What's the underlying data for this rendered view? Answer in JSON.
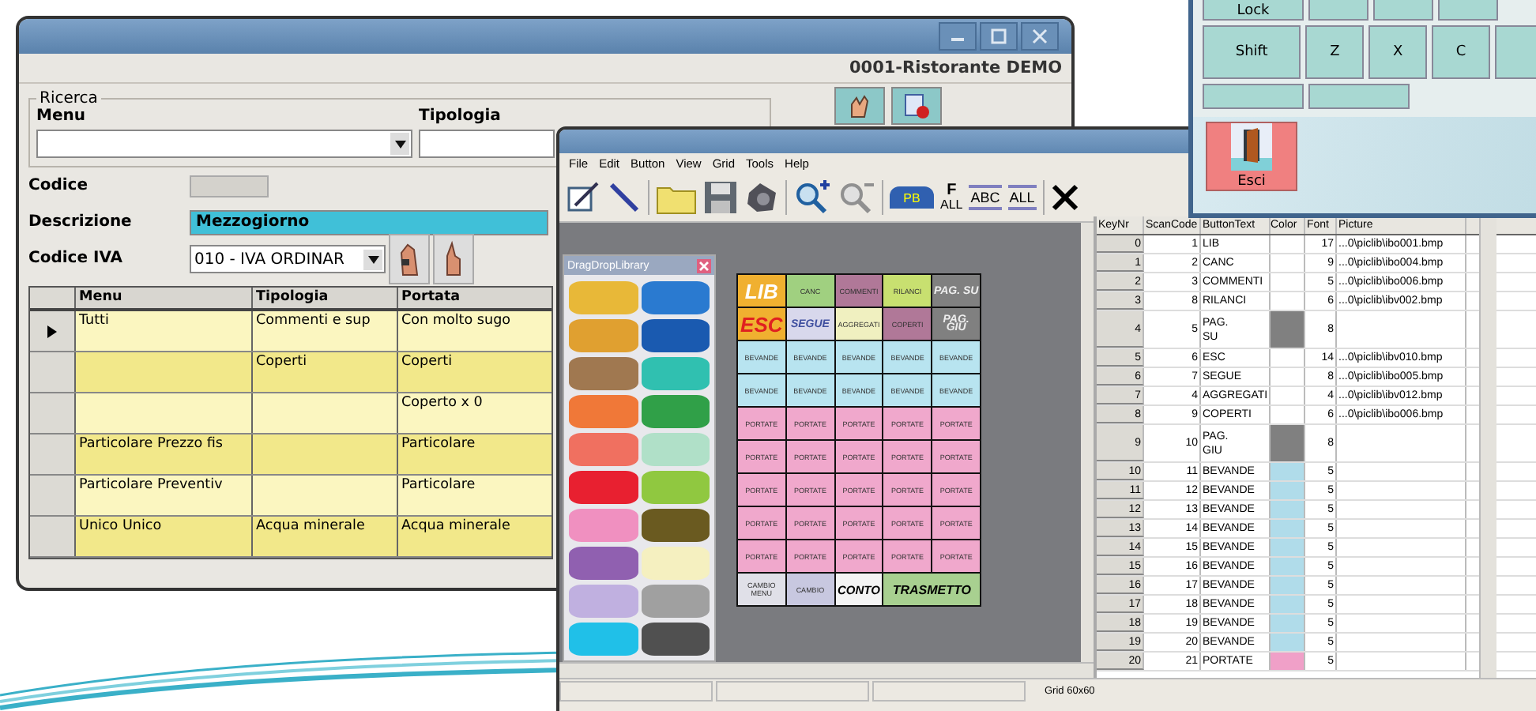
{
  "back_window": {
    "company": "0001-Ristorante DEMO",
    "search": {
      "legend": "Ricerca",
      "menu_label": "Menu",
      "tipologia_label": "Tipologia"
    },
    "form": {
      "codice_label": "Codice",
      "codice_disabled": true,
      "descrizione_label": "Descrizione",
      "descrizione_value": "Mezzogiorno",
      "iva_label": "Codice IVA",
      "iva_value": "010 - IVA ORDINAR"
    },
    "grid": {
      "columns": [
        "Menu",
        "Tipologia",
        "Portata"
      ],
      "rows": [
        {
          "menu": "Tutti",
          "tipologia": "Commenti e sup",
          "portata": "Con molto sugo",
          "selected": true
        },
        {
          "menu": "",
          "tipologia": "Coperti",
          "portata": "Coperti",
          "selected": false
        },
        {
          "menu": "",
          "tipologia": "",
          "portata": "Coperto x 0",
          "selected": false
        },
        {
          "menu": "Particolare Prezzo fis",
          "tipologia": "",
          "portata": "Particolare",
          "selected": false
        },
        {
          "menu": "Particolare Preventiv",
          "tipologia": "",
          "portata": "Particolare",
          "selected": false
        },
        {
          "menu": "Unico Unico",
          "tipologia": "Acqua minerale",
          "portata": "Acqua minerale",
          "selected": false
        }
      ]
    }
  },
  "designer": {
    "menu": [
      "File",
      "Edit",
      "Button",
      "View",
      "Grid",
      "Tools",
      "Help"
    ],
    "toolbar": {
      "pb": "PB",
      "f_all": [
        "F",
        "ALL"
      ],
      "abc": "ABC",
      "all": "ALL"
    },
    "library": {
      "title": "DragDropLibrary",
      "swatches": [
        {
          "color": "#e8b838"
        },
        {
          "color": "#2a7ad0"
        },
        {
          "color": "#e0a030"
        },
        {
          "color": "#1a5ab0"
        },
        {
          "color": "#a07850"
        },
        {
          "color": "#30c0b0"
        },
        {
          "color": "#f07838"
        },
        {
          "color": "#30a048"
        },
        {
          "color": "#f07060"
        },
        {
          "color": "#b0e0c8"
        },
        {
          "color": "#e82030"
        },
        {
          "color": "#90c840"
        },
        {
          "color": "#f090c0"
        },
        {
          "color": "#6a5a20"
        },
        {
          "color": "#9060b0"
        },
        {
          "color": "#f5f0c0"
        },
        {
          "color": "#c0b0e0"
        },
        {
          "color": "#a0a0a0"
        },
        {
          "color": "#20c0e8"
        },
        {
          "color": "#505050"
        }
      ]
    },
    "buttons": [
      {
        "label": "LIB",
        "color": "#f0b030",
        "kind": "big"
      },
      {
        "label": "CANC",
        "color": "#a0d080",
        "kind": "small"
      },
      {
        "label": "COMMENTI",
        "color": "#b07898",
        "kind": "small"
      },
      {
        "label": "RILANCI",
        "color": "#c8e070",
        "kind": "small"
      },
      {
        "label": "PAG. SU",
        "color": "#808080",
        "kind": "page"
      },
      {
        "label": "ESC",
        "color": "#f0b030",
        "kind": "big"
      },
      {
        "label": "SEGUE",
        "color": "#d8d8ec",
        "kind": "medium"
      },
      {
        "label": "AGGREGATI",
        "color": "#f0f0c0",
        "kind": "small"
      },
      {
        "label": "COPERTI",
        "color": "#b07898",
        "kind": "small"
      },
      {
        "label": "PAG. GIU",
        "color": "#808080",
        "kind": "page"
      },
      {
        "label": "BEVANDE",
        "color": "#b8e4f0",
        "kind": "small"
      },
      {
        "label": "BEVANDE",
        "color": "#b8e4f0",
        "kind": "small"
      },
      {
        "label": "BEVANDE",
        "color": "#b8e4f0",
        "kind": "small"
      },
      {
        "label": "BEVANDE",
        "color": "#b8e4f0",
        "kind": "small"
      },
      {
        "label": "BEVANDE",
        "color": "#b8e4f0",
        "kind": "small"
      },
      {
        "label": "BEVANDE",
        "color": "#b8e4f0",
        "kind": "small"
      },
      {
        "label": "BEVANDE",
        "color": "#b8e4f0",
        "kind": "small"
      },
      {
        "label": "BEVANDE",
        "color": "#b8e4f0",
        "kind": "small"
      },
      {
        "label": "BEVANDE",
        "color": "#b8e4f0",
        "kind": "small"
      },
      {
        "label": "BEVANDE",
        "color": "#b8e4f0",
        "kind": "small"
      },
      {
        "label": "PORTATE",
        "color": "#f0a8cc",
        "kind": "small"
      },
      {
        "label": "PORTATE",
        "color": "#f0a8cc",
        "kind": "small"
      },
      {
        "label": "PORTATE",
        "color": "#f0a8cc",
        "kind": "small"
      },
      {
        "label": "PORTATE",
        "color": "#f0a8cc",
        "kind": "small"
      },
      {
        "label": "PORTATE",
        "color": "#f0a8cc",
        "kind": "small"
      },
      {
        "label": "PORTATE",
        "color": "#f0a8cc",
        "kind": "small"
      },
      {
        "label": "PORTATE",
        "color": "#f0a8cc",
        "kind": "small"
      },
      {
        "label": "PORTATE",
        "color": "#f0a8cc",
        "kind": "small"
      },
      {
        "label": "PORTATE",
        "color": "#f0a8cc",
        "kind": "small"
      },
      {
        "label": "PORTATE",
        "color": "#f0a8cc",
        "kind": "small"
      },
      {
        "label": "PORTATE",
        "color": "#f0a8cc",
        "kind": "small"
      },
      {
        "label": "PORTATE",
        "color": "#f0a8cc",
        "kind": "small"
      },
      {
        "label": "PORTATE",
        "color": "#f0a8cc",
        "kind": "small"
      },
      {
        "label": "PORTATE",
        "color": "#f0a8cc",
        "kind": "small"
      },
      {
        "label": "PORTATE",
        "color": "#f0a8cc",
        "kind": "small"
      },
      {
        "label": "PORTATE",
        "color": "#f0a8cc",
        "kind": "small"
      },
      {
        "label": "PORTATE",
        "color": "#f0a8cc",
        "kind": "small"
      },
      {
        "label": "PORTATE",
        "color": "#f0a8cc",
        "kind": "small"
      },
      {
        "label": "PORTATE",
        "color": "#f0a8cc",
        "kind": "small"
      },
      {
        "label": "PORTATE",
        "color": "#f0a8cc",
        "kind": "small"
      },
      {
        "label": "PORTATE",
        "color": "#f0a8cc",
        "kind": "small"
      },
      {
        "label": "PORTATE",
        "color": "#f0a8cc",
        "kind": "small"
      },
      {
        "label": "PORTATE",
        "color": "#f0a8cc",
        "kind": "small"
      },
      {
        "label": "PORTATE",
        "color": "#f0a8cc",
        "kind": "small"
      },
      {
        "label": "PORTATE",
        "color": "#f0a8cc",
        "kind": "small"
      },
      {
        "label": "CAMBIO MENU",
        "color": "#e0e0e8",
        "kind": "small"
      },
      {
        "label": "CAMBIO",
        "color": "#c8c8e0",
        "kind": "small"
      },
      {
        "label": "CONTO",
        "color": "#f4f4f4",
        "kind": "bold"
      },
      {
        "label": "TRASMETTO",
        "color": "#a8d090",
        "kind": "wide"
      }
    ],
    "table": {
      "columns": [
        "KeyNr",
        "ScanCode",
        "ButtonText",
        "Color",
        "Font",
        "Picture"
      ],
      "rows": [
        {
          "key": "0",
          "scan": "1",
          "text": "LIB",
          "font": "17",
          "picture": "...0\\piclib\\ibo001.bmp"
        },
        {
          "key": "1",
          "scan": "2",
          "text": "CANC",
          "font": "9",
          "picture": "...0\\piclib\\ibo004.bmp"
        },
        {
          "key": "2",
          "scan": "3",
          "text": "COMMENTI",
          "font": "5",
          "picture": "...0\\piclib\\ibo006.bmp"
        },
        {
          "key": "3",
          "scan": "8",
          "text": "RILANCI",
          "font": "6",
          "picture": "...0\\piclib\\ibv002.bmp"
        },
        {
          "key": "4",
          "scan": "5",
          "text": "PAG.\nSU",
          "color": "#808080",
          "font": "8",
          "picture": ""
        },
        {
          "key": "5",
          "scan": "6",
          "text": "ESC",
          "font": "14",
          "picture": "...0\\piclib\\ibv010.bmp"
        },
        {
          "key": "6",
          "scan": "7",
          "text": "SEGUE",
          "font": "8",
          "picture": "...0\\piclib\\ibo005.bmp"
        },
        {
          "key": "7",
          "scan": "4",
          "text": "AGGREGATI",
          "font": "4",
          "picture": "...0\\piclib\\ibv012.bmp"
        },
        {
          "key": "8",
          "scan": "9",
          "text": "COPERTI",
          "font": "6",
          "picture": "...0\\piclib\\ibo006.bmp"
        },
        {
          "key": "9",
          "scan": "10",
          "text": "PAG.\nGIU",
          "color": "#808080",
          "font": "8",
          "picture": ""
        },
        {
          "key": "10",
          "scan": "11",
          "text": "BEVANDE",
          "color": "#b0dcea",
          "font": "5",
          "picture": ""
        },
        {
          "key": "11",
          "scan": "12",
          "text": "BEVANDE",
          "color": "#b0dcea",
          "font": "5",
          "picture": ""
        },
        {
          "key": "12",
          "scan": "13",
          "text": "BEVANDE",
          "color": "#b0dcea",
          "font": "5",
          "picture": ""
        },
        {
          "key": "13",
          "scan": "14",
          "text": "BEVANDE",
          "color": "#b0dcea",
          "font": "5",
          "picture": ""
        },
        {
          "key": "14",
          "scan": "15",
          "text": "BEVANDE",
          "color": "#b0dcea",
          "font": "5",
          "picture": ""
        },
        {
          "key": "15",
          "scan": "16",
          "text": "BEVANDE",
          "color": "#b0dcea",
          "font": "5",
          "picture": ""
        },
        {
          "key": "16",
          "scan": "17",
          "text": "BEVANDE",
          "color": "#b0dcea",
          "font": "5",
          "picture": ""
        },
        {
          "key": "17",
          "scan": "18",
          "text": "BEVANDE",
          "color": "#b0dcea",
          "font": "5",
          "picture": ""
        },
        {
          "key": "18",
          "scan": "19",
          "text": "BEVANDE",
          "color": "#b0dcea",
          "font": "5",
          "picture": ""
        },
        {
          "key": "19",
          "scan": "20",
          "text": "BEVANDE",
          "color": "#b0dcea",
          "font": "5",
          "picture": ""
        },
        {
          "key": "20",
          "scan": "21",
          "text": "PORTATE",
          "color": "#f0a0c8",
          "font": "5",
          "picture": ""
        }
      ]
    },
    "status": "Grid 60x60"
  },
  "keyboard": {
    "keys_top": [
      "Lock"
    ],
    "keys_mid": [
      "Shift",
      "Z",
      "X",
      "C"
    ],
    "exit_label": "Esci"
  }
}
